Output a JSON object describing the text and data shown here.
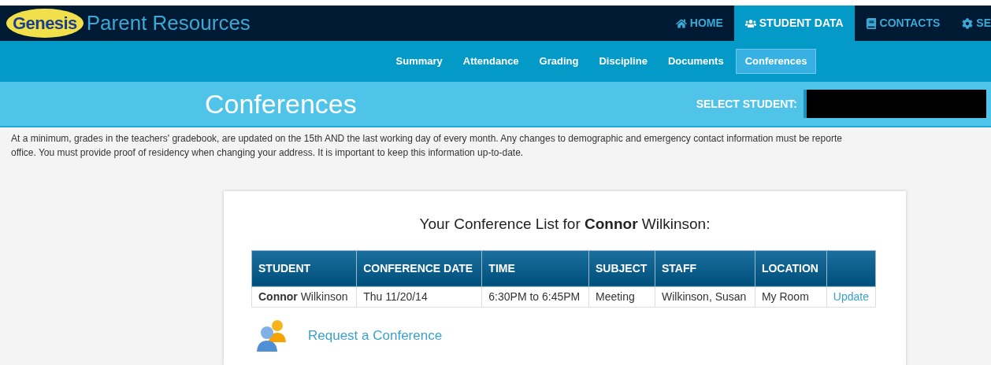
{
  "header": {
    "logo": "Genesis",
    "title": "Parent Resources",
    "nav": [
      {
        "label": "HOME",
        "selected": false
      },
      {
        "label": "STUDENT DATA",
        "selected": true
      },
      {
        "label": "CONTACTS",
        "selected": false
      },
      {
        "label": "SE",
        "selected": false
      }
    ]
  },
  "subnav": [
    {
      "label": "Summary",
      "selected": false
    },
    {
      "label": "Attendance",
      "selected": false
    },
    {
      "label": "Grading",
      "selected": false
    },
    {
      "label": "Discipline",
      "selected": false
    },
    {
      "label": "Documents",
      "selected": false
    },
    {
      "label": "Conferences",
      "selected": true
    }
  ],
  "page_title": "Conferences",
  "select_student": {
    "label": "SELECT STUDENT:",
    "redacted": true
  },
  "notice": [
    "At a minimum, grades in the teachers' gradebook, are updated on the 15th AND the last working day of every month. Any changes to demographic and emergency contact information must be reporte",
    "office. You must provide proof of residency when changing your address. It is important to keep this information up-to-date."
  ],
  "card": {
    "heading": "Your Conference List for **Connor** Wilkinson:",
    "table": {
      "columns": [
        "STUDENT",
        "CONFERENCE DATE",
        "TIME",
        "SUBJECT",
        "STAFF",
        "LOCATION"
      ],
      "rows": [
        {
          "cells": [
            "**Connor** Wilkinson",
            "Thu 11/20/14",
            "6:30PM to 6:45PM",
            "Meeting",
            "Wilkinson, Susan",
            "My Room"
          ],
          "action": "Update"
        }
      ]
    },
    "request_link": "Request a Conference"
  }
}
